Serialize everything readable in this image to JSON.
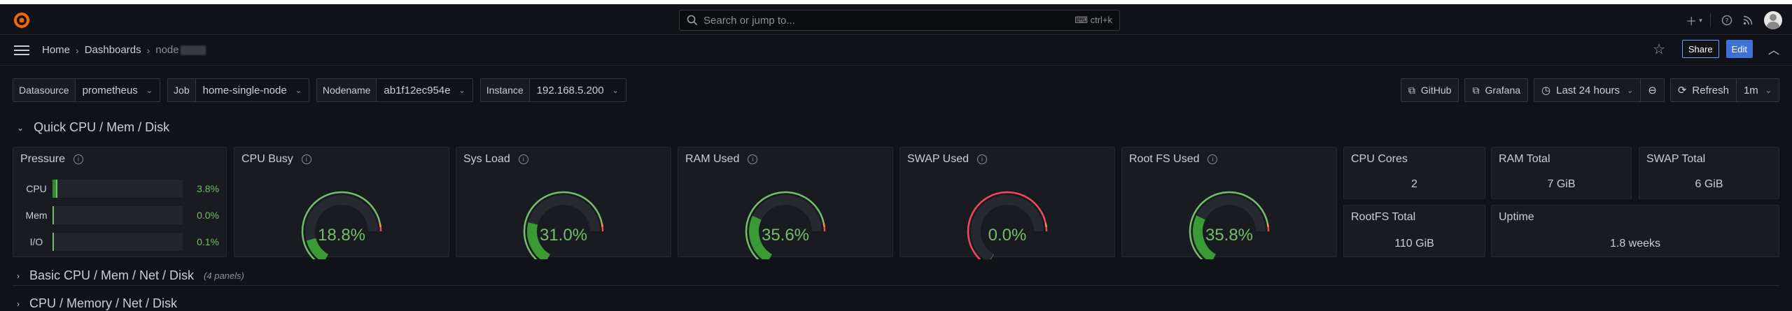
{
  "topbar": {
    "search_placeholder": "Search or jump to...",
    "search_shortcut": "ctrl+k",
    "icons": [
      "grafana-logo-icon",
      "search-icon",
      "keyboard-icon",
      "plus-icon",
      "chevron-down-icon",
      "help-icon",
      "rss-icon",
      "avatar"
    ]
  },
  "breadcrumbs": {
    "home": "Home",
    "dashboards": "Dashboards",
    "current": "node"
  },
  "nav_actions": {
    "share": "Share",
    "edit": "Edit"
  },
  "variables": [
    {
      "label": "Datasource",
      "value": "prometheus"
    },
    {
      "label": "Job",
      "value": "home-single-node"
    },
    {
      "label": "Nodename",
      "value": "ab1f12ec954e"
    },
    {
      "label": "Instance",
      "value": "192.168.5.200"
    }
  ],
  "links": {
    "github": "GitHub",
    "grafana": "Grafana",
    "time_range": "Last 24 hours",
    "refresh": "Refresh",
    "interval": "1m"
  },
  "rows": {
    "quick": "Quick CPU / Mem / Disk",
    "basic": "Basic CPU / Mem / Net / Disk",
    "basic_count": "(4 panels)",
    "next": "CPU / Memory / Net / Disk"
  },
  "colors": {
    "background": "#111217",
    "panel": "#181b1f",
    "green": "#73bf69",
    "red": "#f2495c",
    "accent_blue": "#3d71d9"
  },
  "pressure": {
    "title": "Pressure",
    "items": [
      {
        "label": "CPU",
        "value": "3.8%",
        "fraction": 0.038
      },
      {
        "label": "Mem",
        "value": "0.0%",
        "fraction": 0.0
      },
      {
        "label": "I/O",
        "value": "0.1%",
        "fraction": 0.001
      }
    ]
  },
  "gauges": [
    {
      "title": "CPU Busy",
      "value": "18.8%",
      "fraction": 0.188
    },
    {
      "title": "Sys Load",
      "value": "31.0%",
      "fraction": 0.31
    },
    {
      "title": "RAM Used",
      "value": "35.6%",
      "fraction": 0.356
    },
    {
      "title": "SWAP Used",
      "value": "0.0%",
      "fraction": 0.0
    },
    {
      "title": "Root FS Used",
      "value": "35.8%",
      "fraction": 0.358
    }
  ],
  "stats": {
    "cpu_cores": {
      "title": "CPU Cores",
      "value": "2"
    },
    "ram_total": {
      "title": "RAM Total",
      "value": "7 GiB"
    },
    "swap_total": {
      "title": "SWAP Total",
      "value": "6 GiB"
    },
    "rootfs_total": {
      "title": "RootFS Total",
      "value": "110 GiB"
    },
    "uptime": {
      "title": "Uptime",
      "value": "1.8 weeks"
    }
  }
}
